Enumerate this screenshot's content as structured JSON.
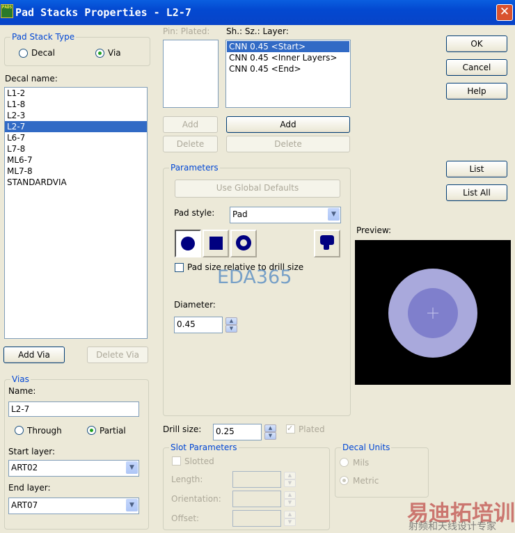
{
  "window": {
    "title": "Pad Stacks Properties - L2-7",
    "app_icon": "PADS"
  },
  "pad_stack_type": {
    "legend": "Pad Stack Type",
    "options": [
      "Decal",
      "Via"
    ],
    "selected": "Via"
  },
  "decal_name": {
    "label": "Decal name:",
    "items": [
      "L1-2",
      "L1-8",
      "L2-3",
      "L2-7",
      "L6-7",
      "L7-8",
      "ML6-7",
      "ML7-8",
      "STANDARDVIA"
    ],
    "selected": "L2-7"
  },
  "buttons": {
    "add_via": "Add Via",
    "delete_via": "Delete Via",
    "ok": "OK",
    "cancel": "Cancel",
    "help": "Help",
    "list": "List",
    "list_all": "List All",
    "add_left": "Add",
    "delete_left": "Delete",
    "add_right": "Add",
    "delete_right": "Delete",
    "use_global": "Use Global Defaults"
  },
  "vias": {
    "legend": "Vias",
    "name_label": "Name:",
    "name_value": "L2-7",
    "options": [
      "Through",
      "Partial"
    ],
    "selected": "Partial",
    "start_label": "Start layer:",
    "start_value": "ART02",
    "end_label": "End layer:",
    "end_value": "ART07"
  },
  "pin_header": "Pin: Plated:",
  "layer_header": "Sh.: Sz.: Layer:",
  "layers": [
    "CNN 0.45 <Start>",
    "CNN 0.45 <Inner Layers>",
    "CNN 0.45 <End>"
  ],
  "parameters": {
    "legend": "Parameters",
    "pad_style_label": "Pad style:",
    "pad_style_value": "Pad",
    "relative_label": "Pad size relative to drill size",
    "diameter_label": "Diameter:",
    "diameter_value": "0.45"
  },
  "drill": {
    "label": "Drill size:",
    "value": "0.25",
    "plated_label": "Plated"
  },
  "slot": {
    "legend": "Slot Parameters",
    "slotted": "Slotted",
    "length": "Length:",
    "orientation": "Orientation:",
    "offset": "Offset:"
  },
  "units": {
    "legend": "Decal Units",
    "options": [
      "Mils",
      "Metric"
    ],
    "selected": "Metric"
  },
  "preview": {
    "label": "Preview:",
    "outer_color": "#a9a9dc",
    "inner_color": "#7f7fcc"
  },
  "watermarks": {
    "eda": "EDA365",
    "cn1": "易迪拓培训",
    "cn2": "射频和天线设计专家"
  }
}
